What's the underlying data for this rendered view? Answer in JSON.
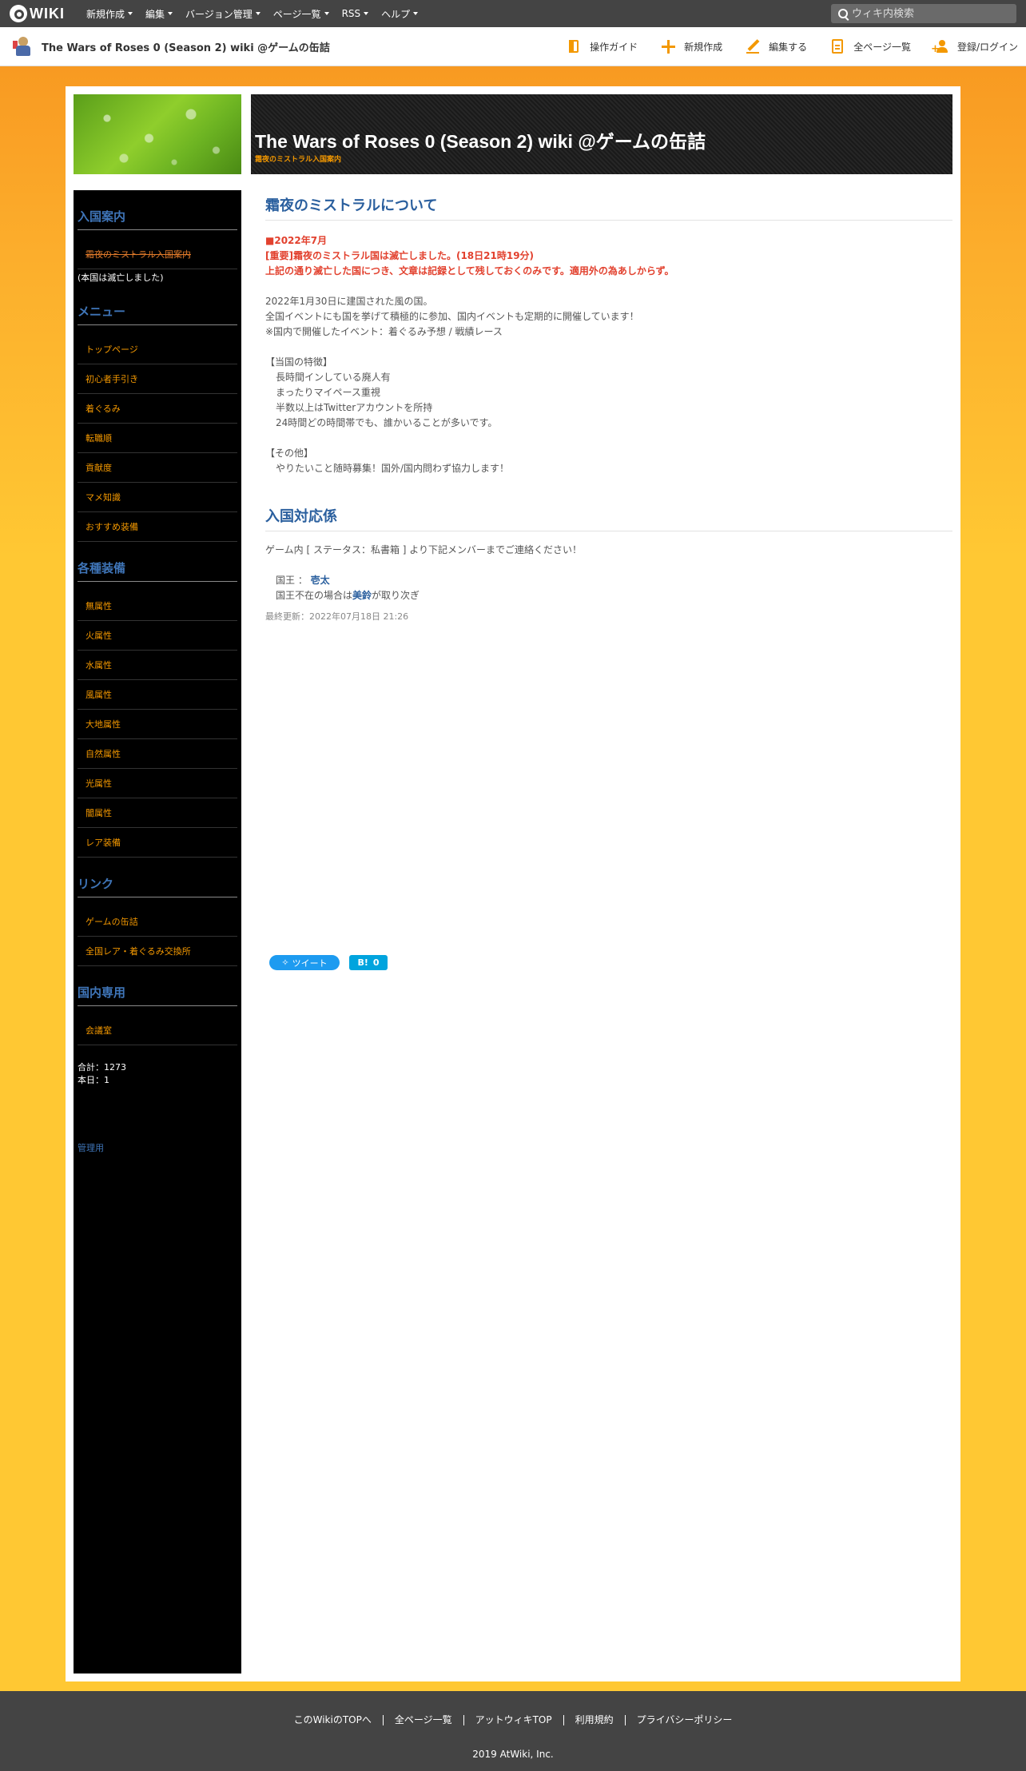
{
  "topbar": {
    "logo_text": "WIKI",
    "menu": [
      "新規作成",
      "編集",
      "バージョン管理",
      "ページ一覧",
      "RSS",
      "ヘルプ"
    ],
    "search_placeholder": "ウィキ内検索"
  },
  "header": {
    "site_title": "The Wars of Roses 0 (Season 2) wiki @ゲームの缶詰",
    "actions": [
      "操作ガイド",
      "新規作成",
      "編集する",
      "全ページ一覧",
      "登録/ログイン"
    ]
  },
  "banner": {
    "title": "The Wars of Roses 0 (Season 2) wiki @ゲームの缶詰",
    "subtitle": "霜夜のミストラル入国案内"
  },
  "sidebar": {
    "sections": [
      {
        "title": "入国案内",
        "items": [
          "霜夜のミストラル入国案内"
        ],
        "note": "(本国は滅亡しました)"
      },
      {
        "title": "メニュー",
        "items": [
          "トップページ",
          "初心者手引き",
          "着ぐるみ",
          "転職順",
          "貢献度",
          "マメ知識",
          "おすすめ装備"
        ]
      },
      {
        "title": "各種装備",
        "items": [
          "無属性",
          "火属性",
          "水属性",
          "風属性",
          "大地属性",
          "自然属性",
          "光属性",
          "闇属性",
          "レア装備"
        ]
      },
      {
        "title": "リンク",
        "items": [
          "ゲームの缶詰",
          "全国レア・着ぐるみ交換所"
        ]
      },
      {
        "title": "国内専用",
        "items": [
          "会議室"
        ]
      }
    ],
    "total": "合計：1273",
    "today": "本日：1",
    "admin": "管理用"
  },
  "content": {
    "h1": "霜夜のミストラルについて",
    "notice": [
      "■2022年7月",
      "[重要]霜夜のミストラル国は滅亡しました。(18日21時19分)",
      "上記の通り滅亡した国につき、文章は記録として残しておくのみです。適用外の為あしからず。"
    ],
    "intro": [
      "2022年1月30日に建国された風の国。",
      "全国イベントにも国を挙げて積極的に参加、国内イベントも定期的に開催しています！",
      "※国内で開催したイベント：着ぐるみ予想 / 戦績レース"
    ],
    "features_title": "【当国の特徴】",
    "features": [
      "長時間インしている廃人有",
      "まったりマイペース重視",
      "半数以上はTwitterアカウントを所持",
      "24時間どの時間帯でも、誰かいることが多いです。"
    ],
    "other_title": "【その他】",
    "other": [
      "やりたいこと随時募集！国外/国内問わず協力します！"
    ],
    "h2": "入国対応係",
    "contact_line": "ゲーム内 [ ステータス：私書箱 ] より下記メンバーまでご連絡ください！",
    "king_label": "国王 ：",
    "king_name": "壱太",
    "absent_pre": "国王不在の場合は",
    "absent_name": "美鈴",
    "absent_post": "が取り次ぎ",
    "updated": "最終更新：2022年07月18日 21:26",
    "tweet": "ツイート",
    "hatena_count": "0"
  },
  "footer": {
    "links": [
      "このWikiのTOPへ",
      "全ページ一覧",
      "アットウィキTOP",
      "利用規約",
      "プライバシーポリシー"
    ],
    "copyright": "2019 AtWiki, Inc."
  },
  "colors": {
    "accent": "#f39800",
    "heading_blue": "#2a5f9e",
    "notice_red": "#e2412e",
    "bar_dark": "#444444"
  }
}
